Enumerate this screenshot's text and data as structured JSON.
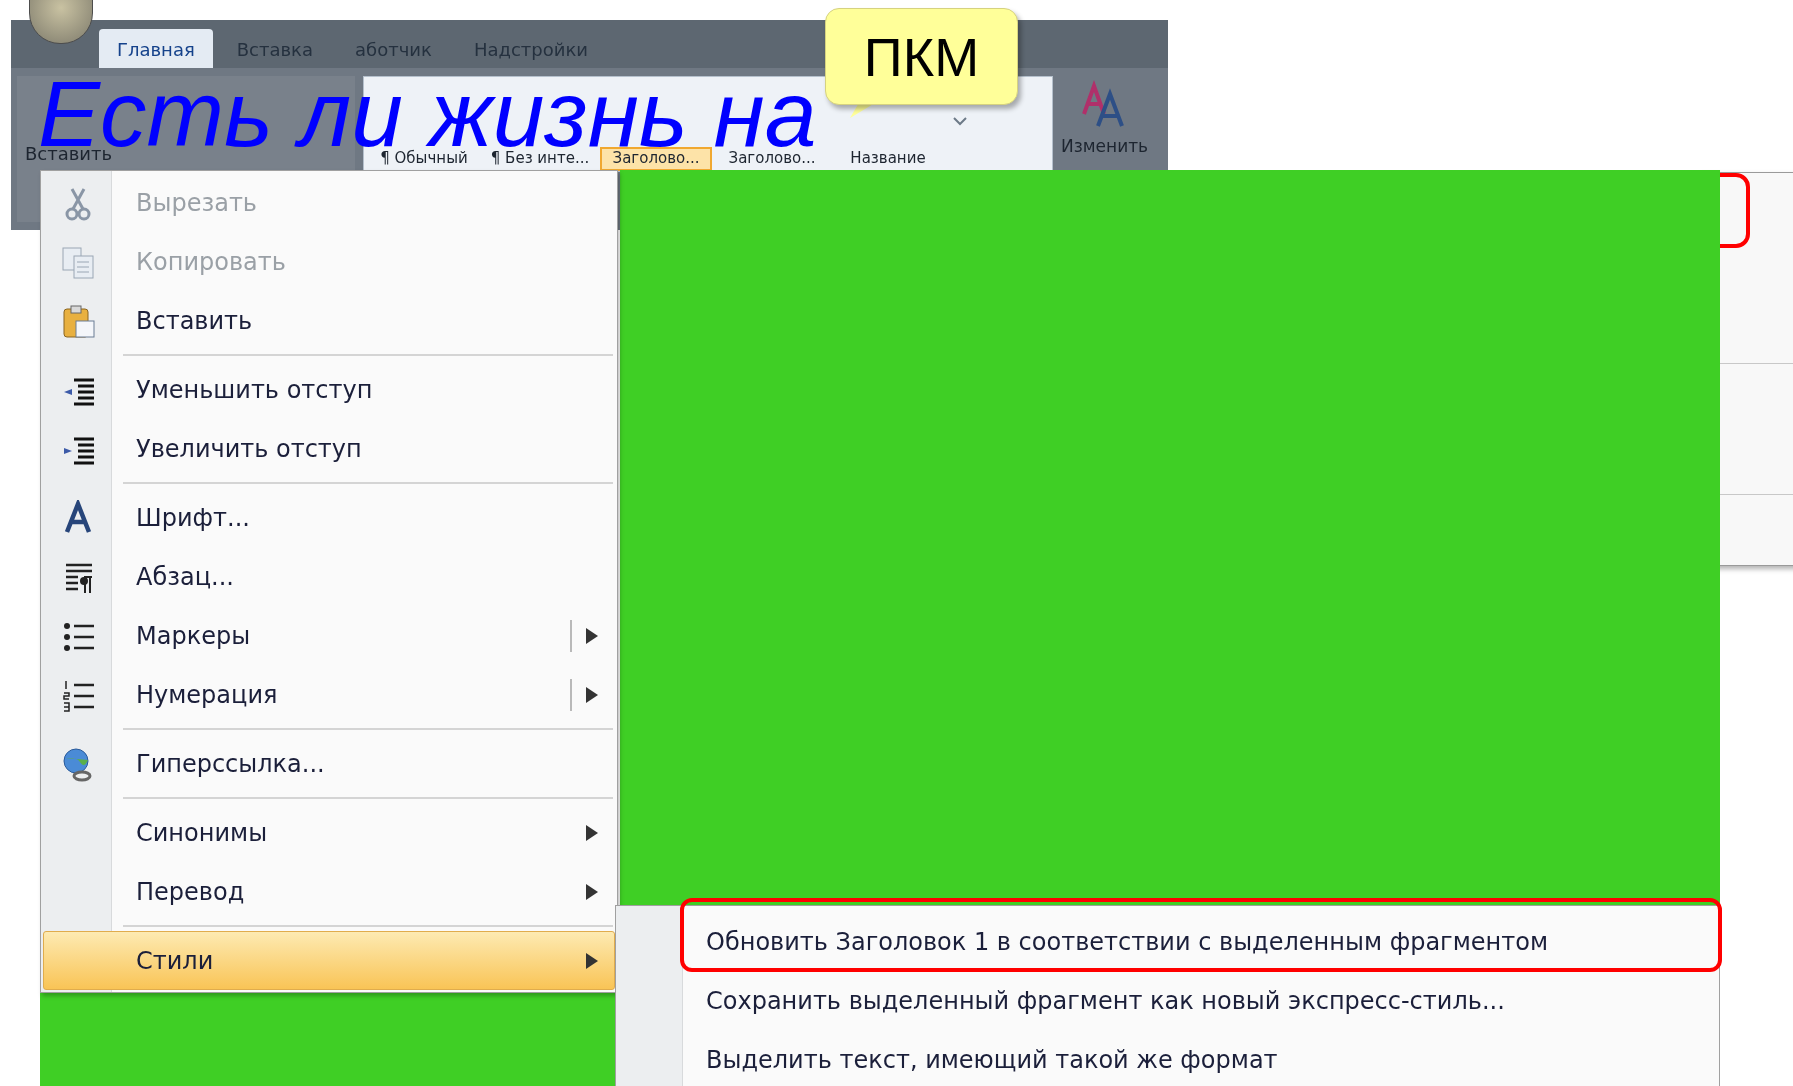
{
  "ribbon": {
    "tabs": [
      {
        "label": "Главная",
        "selected": true
      },
      {
        "label": "Вставка",
        "selected": false
      },
      {
        "label": "аботчик",
        "selected": false
      },
      {
        "label": "Надстройки",
        "selected": false
      }
    ],
    "paste_label": "Вставить",
    "styles": [
      {
        "name": "¶ Обычный",
        "selected": false
      },
      {
        "name": "¶ Без инте...",
        "selected": false
      },
      {
        "name": "Заголово...",
        "selected": true
      },
      {
        "name": "Заголово...",
        "selected": false
      },
      {
        "name": "Название",
        "selected": false
      }
    ],
    "change_label": "Изменить"
  },
  "title": "Есть ли жизнь на",
  "callout": {
    "text": "ПКМ"
  },
  "context_menu": {
    "groups": [
      {
        "items": [
          {
            "label": "Вырезать",
            "disabled": true,
            "selected": false,
            "has_submenu": false,
            "split": false
          },
          {
            "label": "Копировать",
            "disabled": true,
            "selected": false,
            "has_submenu": false,
            "split": false
          },
          {
            "label": "Вставить",
            "disabled": false,
            "selected": false,
            "has_submenu": false,
            "split": false
          }
        ]
      },
      {
        "items": [
          {
            "label": "Уменьшить отступ",
            "disabled": false,
            "selected": false,
            "has_submenu": false,
            "split": false
          },
          {
            "label": "Увеличить отступ",
            "disabled": false,
            "selected": false,
            "has_submenu": false,
            "split": false
          }
        ]
      },
      {
        "items": [
          {
            "label": "Шрифт...",
            "disabled": false,
            "selected": false,
            "has_submenu": false,
            "split": false
          },
          {
            "label": "Абзац...",
            "disabled": false,
            "selected": false,
            "has_submenu": false,
            "split": false
          },
          {
            "label": "Маркеры",
            "disabled": false,
            "selected": false,
            "has_submenu": true,
            "split": true
          },
          {
            "label": "Нумерация",
            "disabled": false,
            "selected": false,
            "has_submenu": true,
            "split": true
          }
        ]
      },
      {
        "items": [
          {
            "label": "Гиперссылка...",
            "disabled": false,
            "selected": false,
            "has_submenu": false,
            "split": false
          }
        ]
      },
      {
        "items": [
          {
            "label": "Синонимы",
            "disabled": false,
            "selected": false,
            "has_submenu": true,
            "split": false
          },
          {
            "label": "Перевод",
            "disabled": false,
            "selected": false,
            "has_submenu": true,
            "split": false
          }
        ]
      },
      {
        "items": [
          {
            "label": "Стили",
            "disabled": false,
            "selected": true,
            "has_submenu": true,
            "split": false
          }
        ]
      }
    ]
  },
  "submenu": {
    "items": [
      {
        "label": "Обновить Заголовок 1 в соответствии с выделенным фрагментом",
        "outlined": true
      },
      {
        "label": "Сохранить выделенный фрагмент как новый экспресс-стиль...",
        "outlined": false
      },
      {
        "label": "Выделить текст, имеющий такой же формат",
        "outlined": false
      }
    ]
  }
}
